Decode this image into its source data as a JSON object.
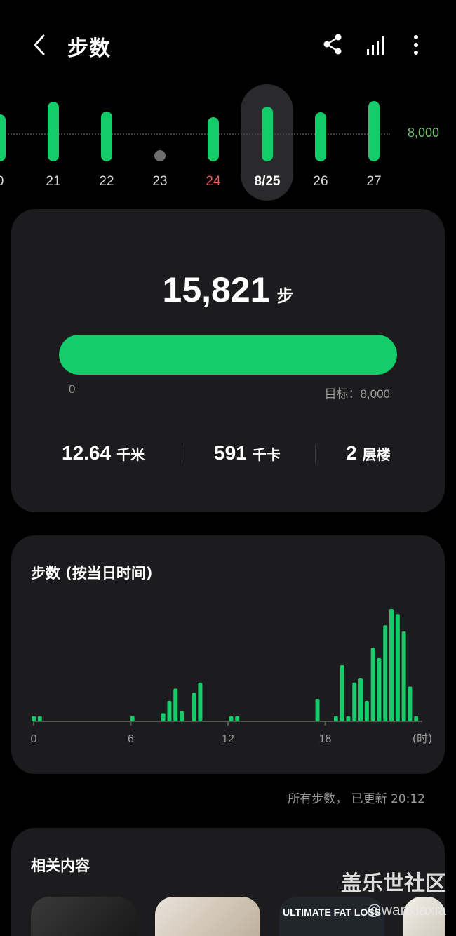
{
  "header": {
    "title": "步数"
  },
  "icons": {
    "back": "chevron-left-icon",
    "share": "share-icon",
    "chart": "signal-bars-icon",
    "more": "more-vertical-icon"
  },
  "colors": {
    "accent": "#14cc6a",
    "weekend": "#ee5b4f",
    "background": "#000000",
    "card": "#1c1c1e"
  },
  "day_strip": {
    "goal_label": "8,000",
    "days": [
      {
        "label": "0",
        "steps": 8300
      },
      {
        "label": "21",
        "steps": 10500
      },
      {
        "label": "22",
        "steps": 8800
      },
      {
        "label": "23",
        "steps": 0
      },
      {
        "label": "24",
        "steps": 7800,
        "weekend": true
      },
      {
        "label": "8/25",
        "steps": 9600,
        "selected": true
      },
      {
        "label": "26",
        "steps": 8600
      },
      {
        "label": "27",
        "steps": 10600
      }
    ]
  },
  "summary": {
    "steps": "15,821",
    "steps_unit": "步",
    "progress_fraction": 1.0,
    "progress_min": "0",
    "goal_text": "目标：8,000",
    "stats": [
      {
        "value": "12.64",
        "unit": "千米"
      },
      {
        "value": "591",
        "unit": "千卡"
      },
      {
        "value": "2",
        "unit": "层楼"
      }
    ]
  },
  "hourly": {
    "title": "步数 (按当日时间)"
  },
  "chart_data": {
    "type": "bar",
    "title": "步数 (按当日时间)",
    "x_ticks": [
      "0",
      "6",
      "12",
      "18"
    ],
    "x_unit": "(时)",
    "x_range": [
      0,
      24
    ],
    "bins_per_hour": 2,
    "values": [
      5,
      5,
      0,
      0,
      0,
      0,
      0,
      0,
      0,
      0,
      0,
      0,
      0,
      0,
      0,
      0,
      5,
      0,
      0,
      0,
      0,
      8,
      20,
      32,
      10,
      0,
      28,
      38,
      0,
      0,
      0,
      0,
      5,
      5,
      0,
      0,
      0,
      0,
      0,
      0,
      0,
      0,
      0,
      0,
      0,
      0,
      22,
      0,
      0,
      5,
      55,
      5,
      38,
      42,
      20,
      72,
      62,
      94,
      110,
      105,
      88,
      34,
      5,
      0
    ]
  },
  "updated": "所有步数， 已更新 20:12",
  "related": {
    "title": "相关内容",
    "cards": [
      {
        "text": ""
      },
      {
        "text": ""
      },
      {
        "text": "ULTIMATE FAT LOSS"
      },
      {
        "text": ""
      }
    ]
  },
  "watermark": {
    "text": "盖乐世社区",
    "sub": "@wanxiaxia"
  }
}
